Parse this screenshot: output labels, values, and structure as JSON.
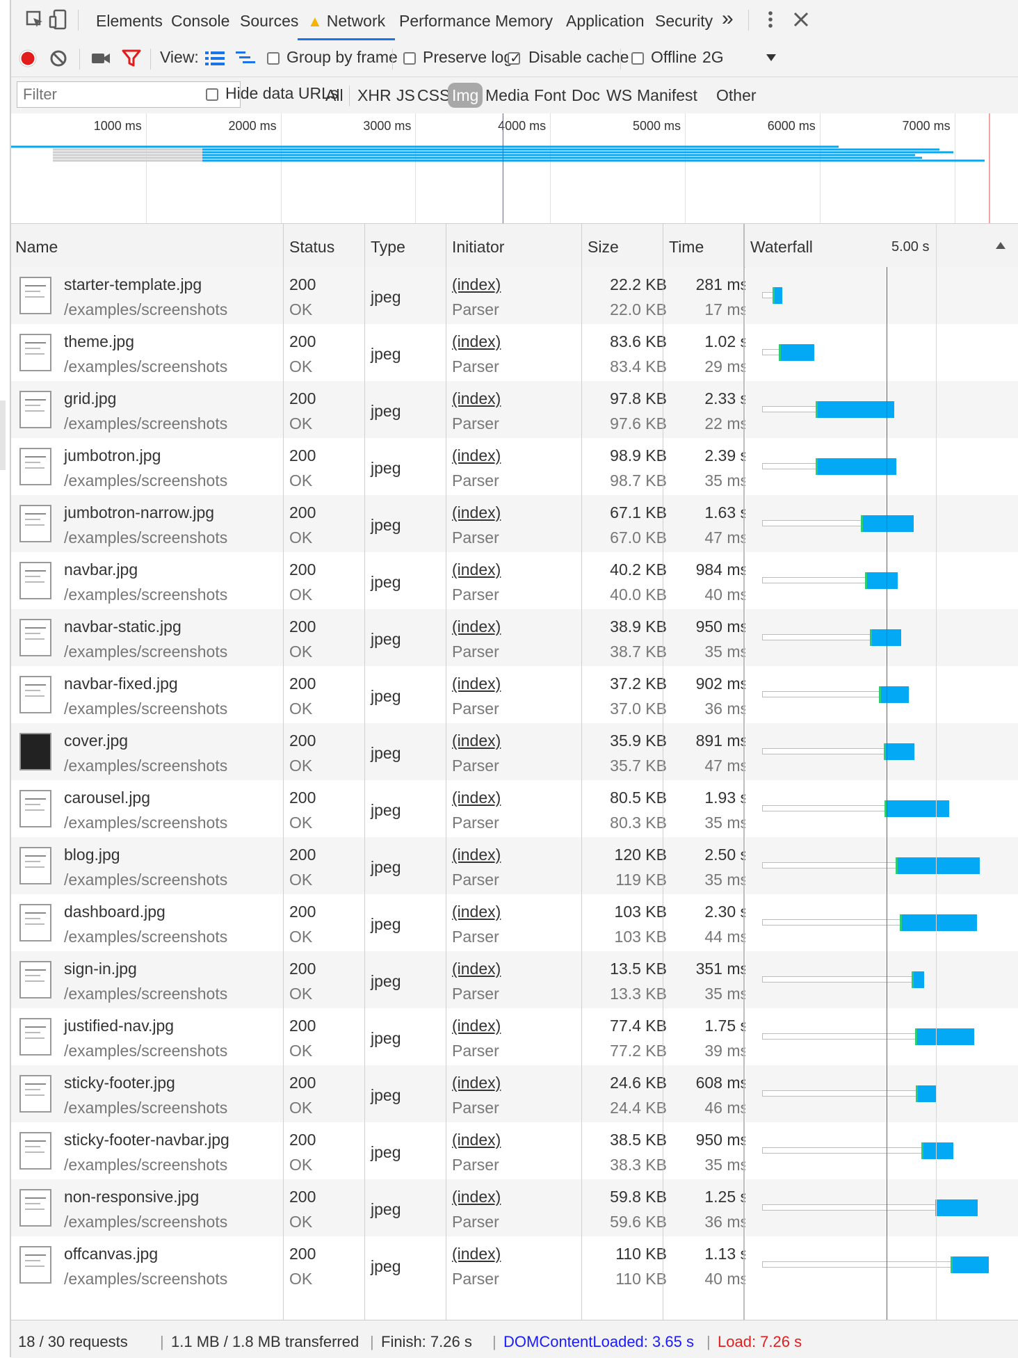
{
  "tabs": {
    "items": [
      "Elements",
      "Console",
      "Sources",
      "Network",
      "Performance",
      "Memory",
      "Application",
      "Security"
    ],
    "active": "Network",
    "more_glyph": "»"
  },
  "toolbar": {
    "view_label": "View:",
    "group_by_frame": "Group by frame",
    "preserve_log": "Preserve log",
    "disable_cache": "Disable cache",
    "offline": "Offline",
    "throttle": "2G",
    "disable_cache_checked": true,
    "record_color": "#e41b1b"
  },
  "filterbar": {
    "placeholder": "Filter",
    "hide_data_urls": "Hide data URLs",
    "types": [
      "All",
      "XHR",
      "JS",
      "CSS",
      "Img",
      "Media",
      "Font",
      "Doc",
      "WS",
      "Manifest",
      "Other"
    ],
    "selected_type": "Img"
  },
  "overview": {
    "ticks": [
      "1000 ms",
      "2000 ms",
      "3000 ms",
      "4000 ms",
      "5000 ms",
      "6000 ms",
      "7000 ms"
    ],
    "domcontentloaded_color": "#5050ff",
    "load_color": "#e84a4a"
  },
  "columns": {
    "name": "Name",
    "status": "Status",
    "type": "Type",
    "initiator": "Initiator",
    "size": "Size",
    "time": "Time",
    "waterfall": "Waterfall",
    "waterfall_scale": "5.00 s"
  },
  "rows": [
    {
      "name": "starter-template.jpg",
      "path": "/examples/screenshots",
      "status": "200",
      "status_text": "OK",
      "type": "jpeg",
      "initiator": "(index)",
      "initiator_type": "Parser",
      "size": "22.2 KB",
      "content": "22.0 KB",
      "time": "281 ms",
      "latency": "17 ms",
      "thumb": "light",
      "wait_start": 0.0,
      "recv_start": 0.049,
      "recv_end": 0.085
    },
    {
      "name": "theme.jpg",
      "path": "/examples/screenshots",
      "status": "200",
      "status_text": "OK",
      "type": "jpeg",
      "initiator": "(index)",
      "initiator_type": "Parser",
      "size": "83.6 KB",
      "content": "83.4 KB",
      "time": "1.02 s",
      "latency": "29 ms",
      "thumb": "light",
      "wait_start": 0.0,
      "recv_start": 0.074,
      "recv_end": 0.208
    },
    {
      "name": "grid.jpg",
      "path": "/examples/screenshots",
      "status": "200",
      "status_text": "OK",
      "type": "jpeg",
      "initiator": "(index)",
      "initiator_type": "Parser",
      "size": "97.8 KB",
      "content": "97.6 KB",
      "time": "2.33 s",
      "latency": "22 ms",
      "thumb": "light",
      "wait_start": 0.0,
      "recv_start": 0.217,
      "recv_end": 0.518
    },
    {
      "name": "jumbotron.jpg",
      "path": "/examples/screenshots",
      "status": "200",
      "status_text": "OK",
      "type": "jpeg",
      "initiator": "(index)",
      "initiator_type": "Parser",
      "size": "98.9 KB",
      "content": "98.7 KB",
      "time": "2.39 s",
      "latency": "35 ms",
      "thumb": "light",
      "wait_start": 0.0,
      "recv_start": 0.217,
      "recv_end": 0.527
    },
    {
      "name": "jumbotron-narrow.jpg",
      "path": "/examples/screenshots",
      "status": "200",
      "status_text": "OK",
      "type": "jpeg",
      "initiator": "(index)",
      "initiator_type": "Parser",
      "size": "67.1 KB",
      "content": "67.0 KB",
      "time": "1.63 s",
      "latency": "47 ms",
      "thumb": "light",
      "wait_start": 0.0,
      "recv_start": 0.392,
      "recv_end": 0.595
    },
    {
      "name": "navbar.jpg",
      "path": "/examples/screenshots",
      "status": "200",
      "status_text": "OK",
      "type": "jpeg",
      "initiator": "(index)",
      "initiator_type": "Parser",
      "size": "40.2 KB",
      "content": "40.0 KB",
      "time": "984 ms",
      "latency": "40 ms",
      "thumb": "light",
      "wait_start": 0.0,
      "recv_start": 0.409,
      "recv_end": 0.533
    },
    {
      "name": "navbar-static.jpg",
      "path": "/examples/screenshots",
      "status": "200",
      "status_text": "OK",
      "type": "jpeg",
      "initiator": "(index)",
      "initiator_type": "Parser",
      "size": "38.9 KB",
      "content": "38.7 KB",
      "time": "950 ms",
      "latency": "35 ms",
      "thumb": "light",
      "wait_start": 0.0,
      "recv_start": 0.426,
      "recv_end": 0.547
    },
    {
      "name": "navbar-fixed.jpg",
      "path": "/examples/screenshots",
      "status": "200",
      "status_text": "OK",
      "type": "jpeg",
      "initiator": "(index)",
      "initiator_type": "Parser",
      "size": "37.2 KB",
      "content": "37.0 KB",
      "time": "902 ms",
      "latency": "36 ms",
      "thumb": "light",
      "wait_start": 0.0,
      "recv_start": 0.462,
      "recv_end": 0.577
    },
    {
      "name": "cover.jpg",
      "path": "/examples/screenshots",
      "status": "200",
      "status_text": "OK",
      "type": "jpeg",
      "initiator": "(index)",
      "initiator_type": "Parser",
      "size": "35.9 KB",
      "content": "35.7 KB",
      "time": "891 ms",
      "latency": "47 ms",
      "thumb": "dark",
      "wait_start": 0.0,
      "recv_start": 0.48,
      "recv_end": 0.597
    },
    {
      "name": "carousel.jpg",
      "path": "/examples/screenshots",
      "status": "200",
      "status_text": "OK",
      "type": "jpeg",
      "initiator": "(index)",
      "initiator_type": "Parser",
      "size": "80.5 KB",
      "content": "80.3 KB",
      "time": "1.93 s",
      "latency": "35 ms",
      "thumb": "light",
      "wait_start": 0.0,
      "recv_start": 0.483,
      "recv_end": 0.733
    },
    {
      "name": "blog.jpg",
      "path": "/examples/screenshots",
      "status": "200",
      "status_text": "OK",
      "type": "jpeg",
      "initiator": "(index)",
      "initiator_type": "Parser",
      "size": "120 KB",
      "content": "119 KB",
      "time": "2.50 s",
      "latency": "35 ms",
      "thumb": "light",
      "wait_start": 0.0,
      "recv_start": 0.527,
      "recv_end": 0.851
    },
    {
      "name": "dashboard.jpg",
      "path": "/examples/screenshots",
      "status": "200",
      "status_text": "OK",
      "type": "jpeg",
      "initiator": "(index)",
      "initiator_type": "Parser",
      "size": "103 KB",
      "content": "103 KB",
      "time": "2.30 s",
      "latency": "44 ms",
      "thumb": "light",
      "wait_start": 0.0,
      "recv_start": 0.542,
      "recv_end": 0.84
    },
    {
      "name": "sign-in.jpg",
      "path": "/examples/screenshots",
      "status": "200",
      "status_text": "OK",
      "type": "jpeg",
      "initiator": "(index)",
      "initiator_type": "Parser",
      "size": "13.5 KB",
      "content": "13.3 KB",
      "time": "351 ms",
      "latency": "35 ms",
      "thumb": "light",
      "wait_start": 0.0,
      "recv_start": 0.589,
      "recv_end": 0.635
    },
    {
      "name": "justified-nav.jpg",
      "path": "/examples/screenshots",
      "status": "200",
      "status_text": "OK",
      "type": "jpeg",
      "initiator": "(index)",
      "initiator_type": "Parser",
      "size": "77.4 KB",
      "content": "77.2 KB",
      "time": "1.75 s",
      "latency": "39 ms",
      "thumb": "light",
      "wait_start": 0.0,
      "recv_start": 0.603,
      "recv_end": 0.829
    },
    {
      "name": "sticky-footer.jpg",
      "path": "/examples/screenshots",
      "status": "200",
      "status_text": "OK",
      "type": "jpeg",
      "initiator": "(index)",
      "initiator_type": "Parser",
      "size": "24.6 KB",
      "content": "24.4 KB",
      "time": "608 ms",
      "latency": "46 ms",
      "thumb": "light",
      "wait_start": 0.0,
      "recv_start": 0.606,
      "recv_end": 0.685
    },
    {
      "name": "sticky-footer-navbar.jpg",
      "path": "/examples/screenshots",
      "status": "200",
      "status_text": "OK",
      "type": "jpeg",
      "initiator": "(index)",
      "initiator_type": "Parser",
      "size": "38.5 KB",
      "content": "38.3 KB",
      "time": "950 ms",
      "latency": "35 ms",
      "thumb": "light",
      "wait_start": 0.0,
      "recv_start": 0.627,
      "recv_end": 0.749
    },
    {
      "name": "non-responsive.jpg",
      "path": "/examples/screenshots",
      "status": "200",
      "status_text": "OK",
      "type": "jpeg",
      "initiator": "(index)",
      "initiator_type": "Parser",
      "size": "59.8 KB",
      "content": "59.6 KB",
      "time": "1.25 s",
      "latency": "36 ms",
      "thumb": "light",
      "wait_start": 0.0,
      "recv_start": 0.68,
      "recv_end": 0.842
    },
    {
      "name": "offcanvas.jpg",
      "path": "/examples/screenshots",
      "status": "200",
      "status_text": "OK",
      "type": "jpeg",
      "initiator": "(index)",
      "initiator_type": "Parser",
      "size": "110 KB",
      "content": "110 KB",
      "time": "1.13 s",
      "latency": "40 ms",
      "thumb": "light",
      "wait_start": 0.0,
      "recv_start": 0.74,
      "recv_end": 0.887
    }
  ],
  "statusbar": {
    "requests": "18 / 30 requests",
    "transferred": "1.1 MB / 1.8 MB transferred",
    "finish": "Finish: 7.26 s",
    "dcl": "DOMContentLoaded: 3.65 s",
    "load": "Load: 7.26 s",
    "dcl_color": "#1a1aff",
    "load_color": "#e02020"
  }
}
